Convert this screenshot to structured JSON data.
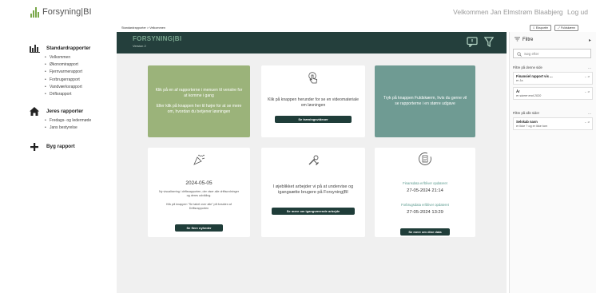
{
  "header": {
    "logo_text": "Forsyning|BI",
    "welcome": "Velkommen Jan Elmstrøm Blaabjerg",
    "logout": "Log ud"
  },
  "sidebar": {
    "sections": [
      {
        "title": "Standardrapporter",
        "icon": "bar-chart-icon",
        "items": [
          "Velkommen",
          "Økonomirapport",
          "Fjernvarmerapport",
          "Forbrugerrapport",
          "Vandværksrapport",
          "Driftsrapport"
        ]
      },
      {
        "title": "Jeres rapporter",
        "icon": "home-icon",
        "items": [
          "Fredags- og ledermøde",
          "Jans bestyrelse"
        ]
      },
      {
        "title": "Byg rapport",
        "icon": "plus-icon",
        "items": []
      }
    ]
  },
  "breadcrumb": "Standardrapporter > Velkommen",
  "toolbar": {
    "export_label": "Eksportér",
    "fullscreen_label": "Fuldskærm"
  },
  "main": {
    "title": "FORSYNING|BI",
    "version": "Version 2",
    "cards": {
      "intro_text1": "Klik på en af rapporterne i menuen til venstre for at komme i gang",
      "intro_text2": "Eller klik på knappen her til højre for at se mere om, hvordan du betjener løsningen",
      "video_text": "Klik på knappen herunder for se en videomateriale om løsningen",
      "video_button": "Se træningsvideoer",
      "fullscreen_text": "Tryk på knappen Fuldskærm, hvis du gerne vil se rapporterne i en større udgave",
      "news_date": "2024-05-05",
      "news_text1": "Ny visualisering i driftsrapporten, der viser alle driftsordninger og deres udvikling.",
      "news_text2": "Klik på knappen \"Se tabel over alle\" på forsiden af Driftsrapporten",
      "news_button": "Se flere nyheder",
      "work_text": "I øjeblikket arbejder vi på at undervise og igangsætte brugere på Forsyning|BI",
      "work_button": "Se mere om igangværende arbejde",
      "data_label1": "Finansdata er/bliver opdateret",
      "data_date1": "27-05-2024 21:14",
      "data_label2": "Forbrugsdata er/bliver opdateret",
      "data_date2": "27-05-2024 13:29",
      "data_button": "Se mere om dine data"
    }
  },
  "filters": {
    "title": "Filtre",
    "search_placeholder": "Søg efter",
    "page_section": "Filtre på denne side",
    "page_filters": [
      {
        "name": "Finansiel rapport vis ...",
        "value": "er Ja"
      },
      {
        "name": "År",
        "value": "er større end 2020"
      }
    ],
    "all_section": "Filtre på alle sider",
    "all_filters": [
      {
        "name": "Selskab navn",
        "value": "er ikke ? og er ikke tom"
      }
    ]
  },
  "colors": {
    "header_bg": "#243f3c",
    "green_card": "#9bb37a",
    "teal_card": "#6f9b93",
    "button_bg": "#1f3d39",
    "logo_green": "#7aa84a"
  }
}
